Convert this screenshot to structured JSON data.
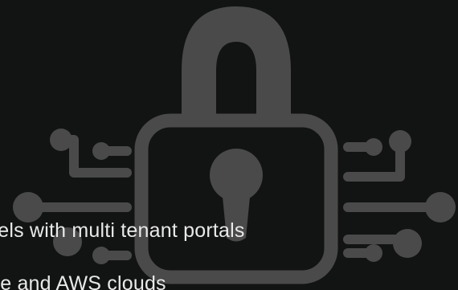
{
  "hero": {
    "lines": [
      "Models with multi tenant portals",
      "Azure and AWS clouds"
    ]
  },
  "icons": {
    "main": "padlock-circuit-icon"
  },
  "colors": {
    "background": "#121413",
    "icon_gray": "#4a4a4a",
    "text": "#e9e9e9"
  }
}
